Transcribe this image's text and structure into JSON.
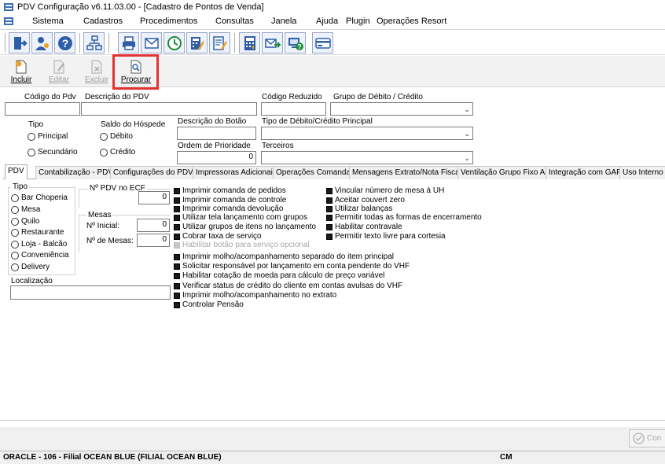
{
  "window": {
    "title": "PDV Configuração v6.11.03.00 - [Cadastro de Pontos de Venda]"
  },
  "menu": [
    "Sistema",
    "Cadastros",
    "Procedimentos",
    "Consultas",
    "Janela",
    "Ajuda",
    "Plugin",
    "Operações Resort"
  ],
  "toolbar_icons": [
    "exit-icon",
    "users-icon",
    "help-icon",
    "network-icon",
    "printer-icon",
    "mail-icon",
    "clock-icon",
    "calculator-edit-icon",
    "document-edit-icon",
    "calculator-icon",
    "mail-transfer-icon",
    "computer-help-icon",
    "card-icon"
  ],
  "actions": {
    "incluir": "Incluir",
    "editar": "Editar",
    "excluir": "Excluir",
    "procurar": "Procurar"
  },
  "form": {
    "codigo_pdv": {
      "label": "Código do Pdv",
      "value": ""
    },
    "descricao_pdv": {
      "label": "Descrição do PDV",
      "value": ""
    },
    "codigo_reduzido": {
      "label": "Código Reduzido",
      "value": ""
    },
    "grupo_debito_credito": {
      "label": "Grupo de Débito / Crédito",
      "value": ""
    },
    "tipo": {
      "label": "Tipo",
      "options": [
        "Principal",
        "Secundário"
      ]
    },
    "saldo_hospede": {
      "label": "Saldo do Hóspede",
      "options": [
        "Débito",
        "Crédito"
      ]
    },
    "descricao_botao": {
      "label": "Descrição do Botão",
      "value": ""
    },
    "tipo_debito_credito_principal": {
      "label": "Tipo de Débito/Crédito Principal",
      "value": ""
    },
    "ordem_prioridade": {
      "label": "Ordem de Prioridade",
      "value": "0"
    },
    "terceiros": {
      "label": "Terceiros",
      "value": ""
    }
  },
  "tabs": [
    "PDV",
    "Contabilização - PDV",
    "Configurações do PDV",
    "Impressoras Adicionais",
    "Operações Comanda",
    "Mensagens Extrato/Nota Fiscal",
    "Ventilação Grupo Fixo AB",
    "Integração com GAP",
    "Uso Interno"
  ],
  "pdv_tab": {
    "tipo_label": "Tipo",
    "tipo_options": [
      "Bar Choperia",
      "Mesa",
      "Quilo",
      "Restaurante",
      "Loja - Balcão",
      "Conveniência",
      "Delivery"
    ],
    "pdv_ecf": {
      "label": "Nº PDV no ECF",
      "value": "0"
    },
    "mesas_label": "Mesas",
    "mesa_inicial": {
      "label": "Nº Inicial:",
      "value": "0"
    },
    "num_mesas": {
      "label": "Nº de Mesas:",
      "value": "0"
    },
    "localizacao": {
      "label": "Localização",
      "value": ""
    },
    "checks_col1": [
      "Imprimir comanda de pedidos",
      "Imprimir comanda de controle",
      "Imprimir comanda devolução",
      "Utilizar tela lançamento com grupos",
      "Utilizar grupos de itens no lançamento",
      "Cobrar taxa de serviço",
      "Habilitar botão para serviço opcional",
      "Imprimir molho/acompanhamento separado do item principal",
      "Solicitar responsável por lançamento em conta pendente do VHF",
      "Habilitar cotação de moeda para cálculo de preço variável",
      "Verificar status de crédito do cliente em contas avulsas do VHF",
      "Imprimir molho/acompanhamento no extrato",
      "Controlar Pensão"
    ],
    "checks_col2": [
      "Vincular número de mesa à UH",
      "Aceitar couvert zero",
      "Utilizar balanças",
      "Permitir todas as formas de encerramento",
      "Habilitar contravale",
      "Permitir texto livre para cortesia"
    ]
  },
  "confirm_label": "Con",
  "status": {
    "left": "ORACLE - 106 - Filial OCEAN BLUE (FILIAL OCEAN BLUE)",
    "right": "CM"
  }
}
